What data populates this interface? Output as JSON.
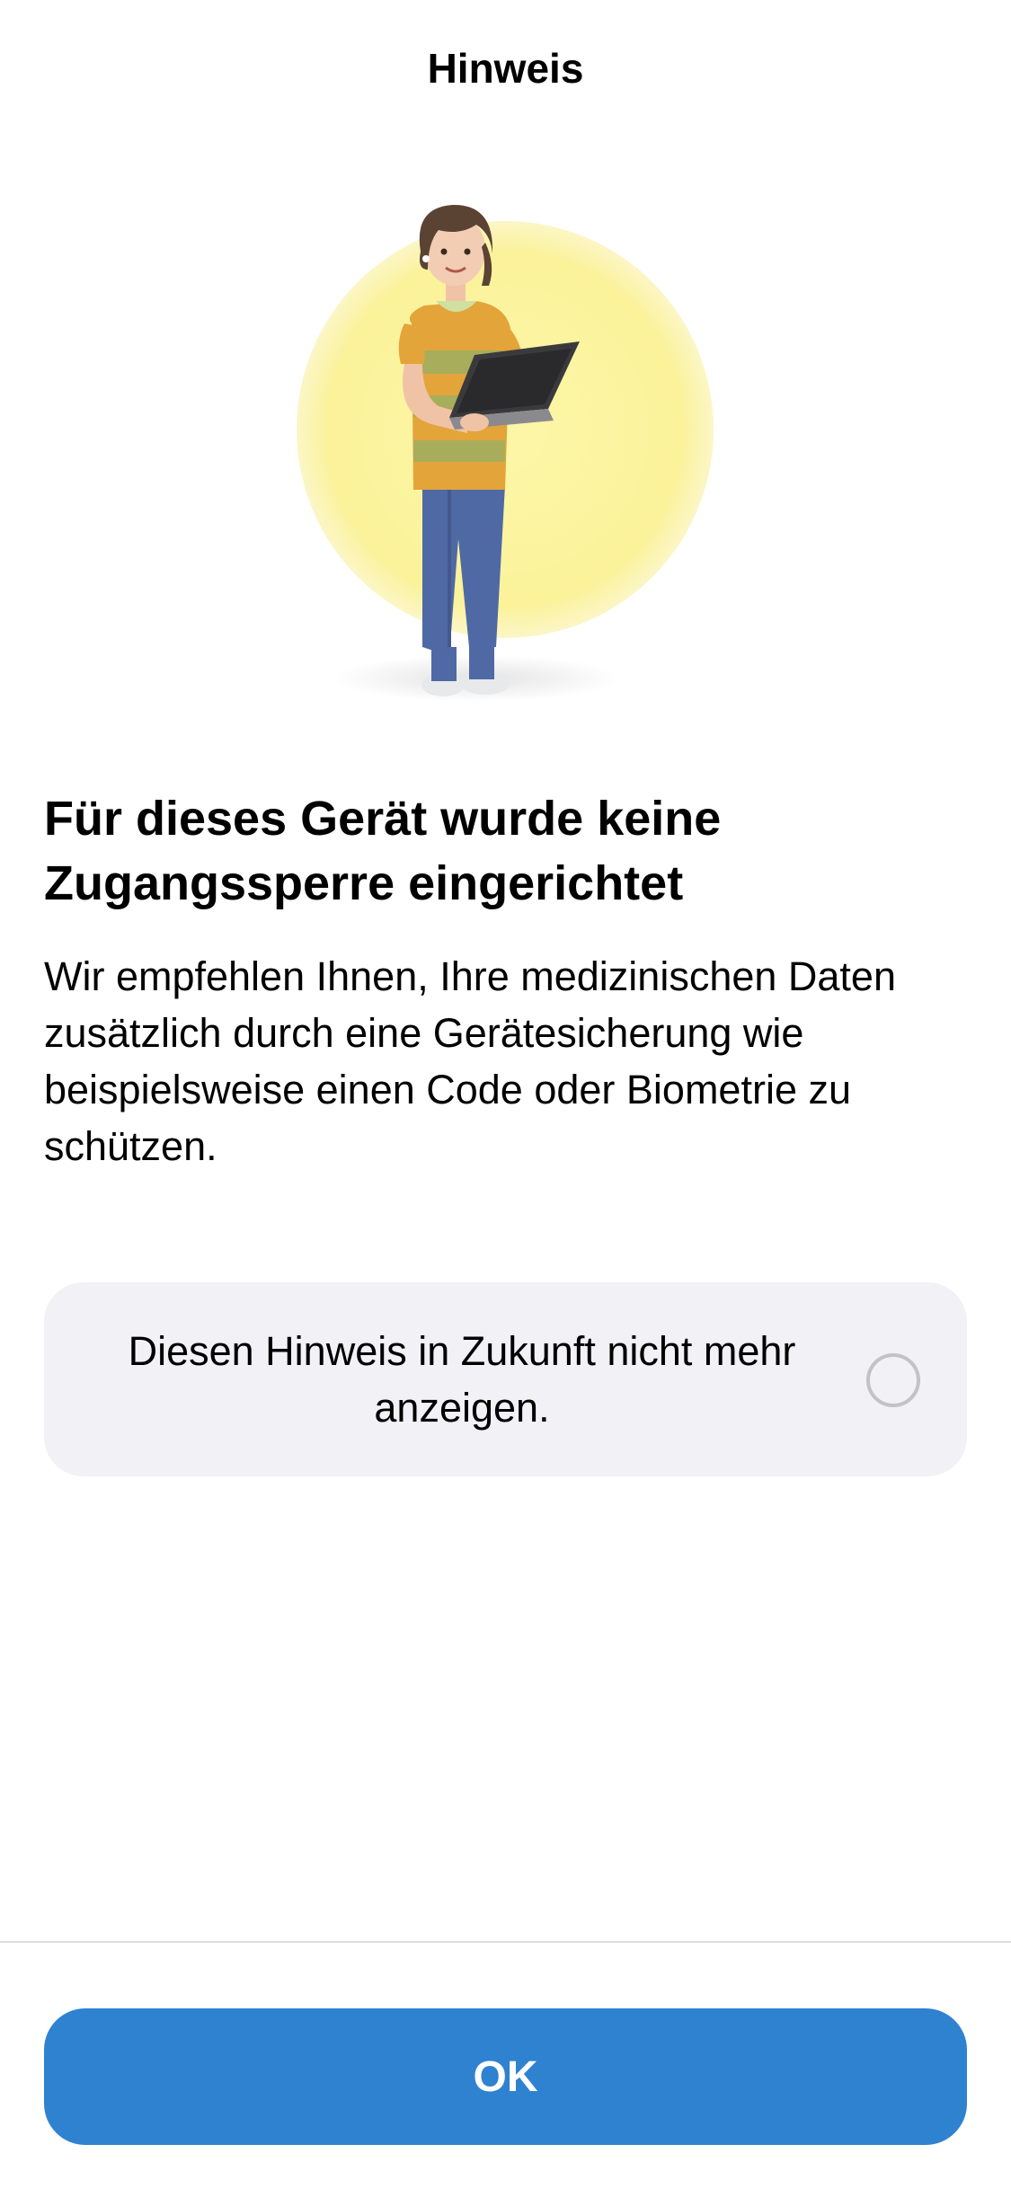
{
  "header": {
    "title": "Hinweis"
  },
  "illustration": {
    "icon": "woman-with-laptop-illustration",
    "accent_color": "#fbf29a"
  },
  "main": {
    "headline": "Für dieses Gerät wurde keine Zugangssperre eingerichtet",
    "body": "Wir empfehlen Ihnen, Ihre medizinischen Daten zusätzlich durch eine Gerätesicherung wie beispielsweise einen Code oder Biometrie zu schützen."
  },
  "option": {
    "label": "Diesen Hinweis in Zukunft nicht mehr anzeigen.",
    "checked": false
  },
  "footer": {
    "ok_label": "OK",
    "button_color": "#2f82d0"
  }
}
